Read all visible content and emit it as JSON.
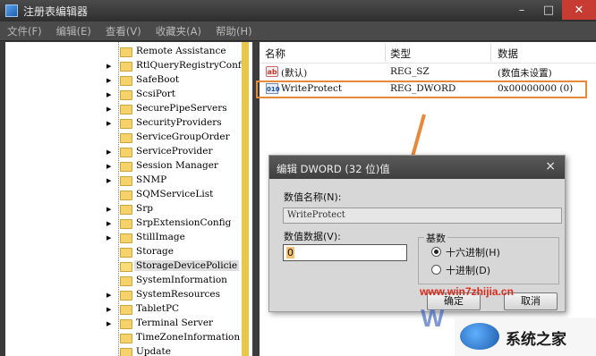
{
  "window": {
    "title": "注册表编辑器"
  },
  "menu": [
    "文件(F)",
    "编辑(E)",
    "查看(V)",
    "收藏夹(A)",
    "帮助(H)"
  ],
  "tree": {
    "items": [
      {
        "label": "Remote Assistance",
        "expandable": false
      },
      {
        "label": "RtlQueryRegistryConf",
        "expandable": true
      },
      {
        "label": "SafeBoot",
        "expandable": true
      },
      {
        "label": "ScsiPort",
        "expandable": true
      },
      {
        "label": "SecurePipeServers",
        "expandable": true
      },
      {
        "label": "SecurityProviders",
        "expandable": true
      },
      {
        "label": "ServiceGroupOrder",
        "expandable": false
      },
      {
        "label": "ServiceProvider",
        "expandable": true
      },
      {
        "label": "Session Manager",
        "expandable": true
      },
      {
        "label": "SNMP",
        "expandable": true
      },
      {
        "label": "SQMServiceList",
        "expandable": false
      },
      {
        "label": "Srp",
        "expandable": true
      },
      {
        "label": "SrpExtensionConfig",
        "expandable": true
      },
      {
        "label": "StillImage",
        "expandable": true
      },
      {
        "label": "Storage",
        "expandable": false
      },
      {
        "label": "StorageDevicePolicie",
        "expandable": false,
        "selected": true
      },
      {
        "label": "SystemInformation",
        "expandable": false
      },
      {
        "label": "SystemResources",
        "expandable": true
      },
      {
        "label": "TabletPC",
        "expandable": true
      },
      {
        "label": "Terminal Server",
        "expandable": true
      },
      {
        "label": "TimeZoneInformation",
        "expandable": false
      },
      {
        "label": "Update",
        "expandable": false
      }
    ]
  },
  "list": {
    "headers": {
      "name": "名称",
      "type": "类型",
      "data": "数据"
    },
    "rows": [
      {
        "icon": "ab",
        "name": "(默认)",
        "type": "REG_SZ",
        "data": "(数值未设置)"
      },
      {
        "icon": "010",
        "name": "WriteProtect",
        "type": "REG_DWORD",
        "data": "0x00000000  (0)"
      }
    ]
  },
  "dialog": {
    "title": "编辑 DWORD (32 位)值",
    "close": "×",
    "name_label": "数值名称(N):",
    "name_value": "WriteProtect",
    "data_label": "数值数据(V):",
    "data_value": "0",
    "base_label": "基数",
    "hex_label": "十六进制(H)",
    "dec_label": "十进制(D)",
    "ok_label": "确定",
    "cancel_label": "取消",
    "base_selected": "hex"
  },
  "watermark": {
    "url": "www.win7zhijia.cn",
    "logo_mark": "W",
    "brand": "系统之家"
  },
  "colors": {
    "highlight": "#e58a3a",
    "arrow": "#e8883a",
    "selection_bar": "#e8c84a"
  }
}
